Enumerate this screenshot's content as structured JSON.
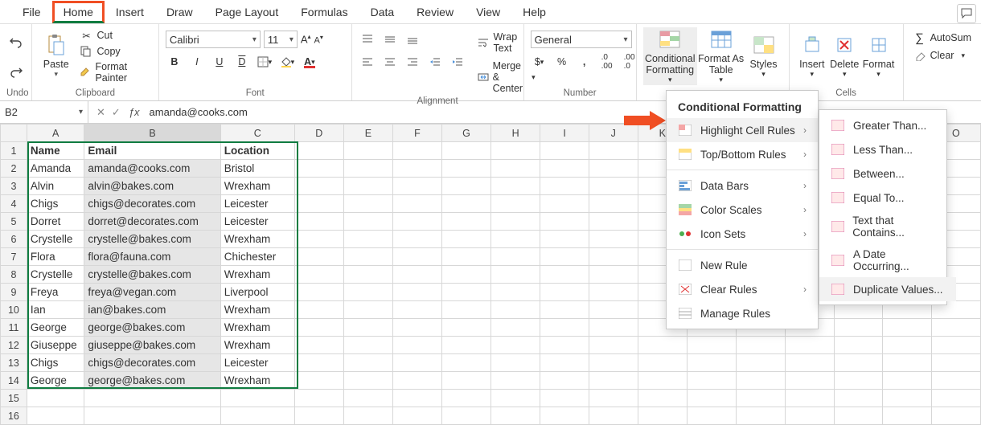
{
  "tabs": [
    "File",
    "Home",
    "Insert",
    "Draw",
    "Page Layout",
    "Formulas",
    "Data",
    "Review",
    "View",
    "Help"
  ],
  "active_tab": "Home",
  "ribbon": {
    "undo_label": "Undo",
    "clipboard": {
      "paste": "Paste",
      "cut": "Cut",
      "copy": "Copy",
      "format_painter": "Format Painter",
      "label": "Clipboard"
    },
    "font": {
      "name": "Calibri",
      "size": "11",
      "label": "Font",
      "bold": "B",
      "italic": "I",
      "underline": "U"
    },
    "alignment": {
      "wrap": "Wrap Text",
      "merge": "Merge & Center",
      "label": "Alignment"
    },
    "number": {
      "format": "General",
      "label": "Number"
    },
    "styles": {
      "cond": "Conditional Formatting",
      "format_as_table": "Format As Table",
      "styles": "Styles",
      "label": ""
    },
    "cells": {
      "insert": "Insert",
      "delete": "Delete",
      "format": "Format",
      "label": "Cells"
    },
    "editing": {
      "autosum": "AutoSum",
      "clear": "Clear"
    }
  },
  "cond_menu": {
    "title": "Conditional Formatting",
    "items": [
      "Highlight Cell Rules",
      "Top/Bottom Rules",
      "Data Bars",
      "Color Scales",
      "Icon Sets",
      "New Rule",
      "Clear Rules",
      "Manage Rules"
    ]
  },
  "hcr_menu": {
    "items": [
      "Greater Than...",
      "Less Than...",
      "Between...",
      "Equal To...",
      "Text that Contains...",
      "A Date Occurring...",
      "Duplicate Values..."
    ]
  },
  "namebox": "B2",
  "formula": "amanda@cooks.com",
  "columns": [
    "A",
    "B",
    "C",
    "D",
    "E",
    "F",
    "G",
    "H",
    "I",
    "",
    "",
    "",
    "",
    "",
    "",
    "",
    "O"
  ],
  "headers": {
    "A": "Name",
    "B": "Email",
    "C": "Location"
  },
  "rows": [
    {
      "A": "Amanda",
      "B": "amanda@cooks.com",
      "C": "Bristol"
    },
    {
      "A": "Alvin",
      "B": "alvin@bakes.com",
      "C": "Wrexham"
    },
    {
      "A": "Chigs",
      "B": "chigs@decorates.com",
      "C": "Leicester"
    },
    {
      "A": "Dorret",
      "B": "dorret@decorates.com",
      "C": "Leicester"
    },
    {
      "A": "Crystelle",
      "B": "crystelle@bakes.com",
      "C": "Wrexham"
    },
    {
      "A": "Flora",
      "B": "flora@fauna.com",
      "C": "Chichester"
    },
    {
      "A": "Crystelle",
      "B": "crystelle@bakes.com",
      "C": "Wrexham"
    },
    {
      "A": "Freya",
      "B": "freya@vegan.com",
      "C": "Liverpool"
    },
    {
      "A": "Ian",
      "B": "ian@bakes.com",
      "C": "Wrexham"
    },
    {
      "A": "George",
      "B": "george@bakes.com",
      "C": "Wrexham"
    },
    {
      "A": "Giuseppe",
      "B": "giuseppe@bakes.com",
      "C": "Wrexham"
    },
    {
      "A": "Chigs",
      "B": "chigs@decorates.com",
      "C": "Leicester"
    },
    {
      "A": "George",
      "B": "george@bakes.com",
      "C": "Wrexham"
    }
  ],
  "annotations": {
    "home_box_color": "#f04e23",
    "arrow_color": "#f04e23"
  }
}
